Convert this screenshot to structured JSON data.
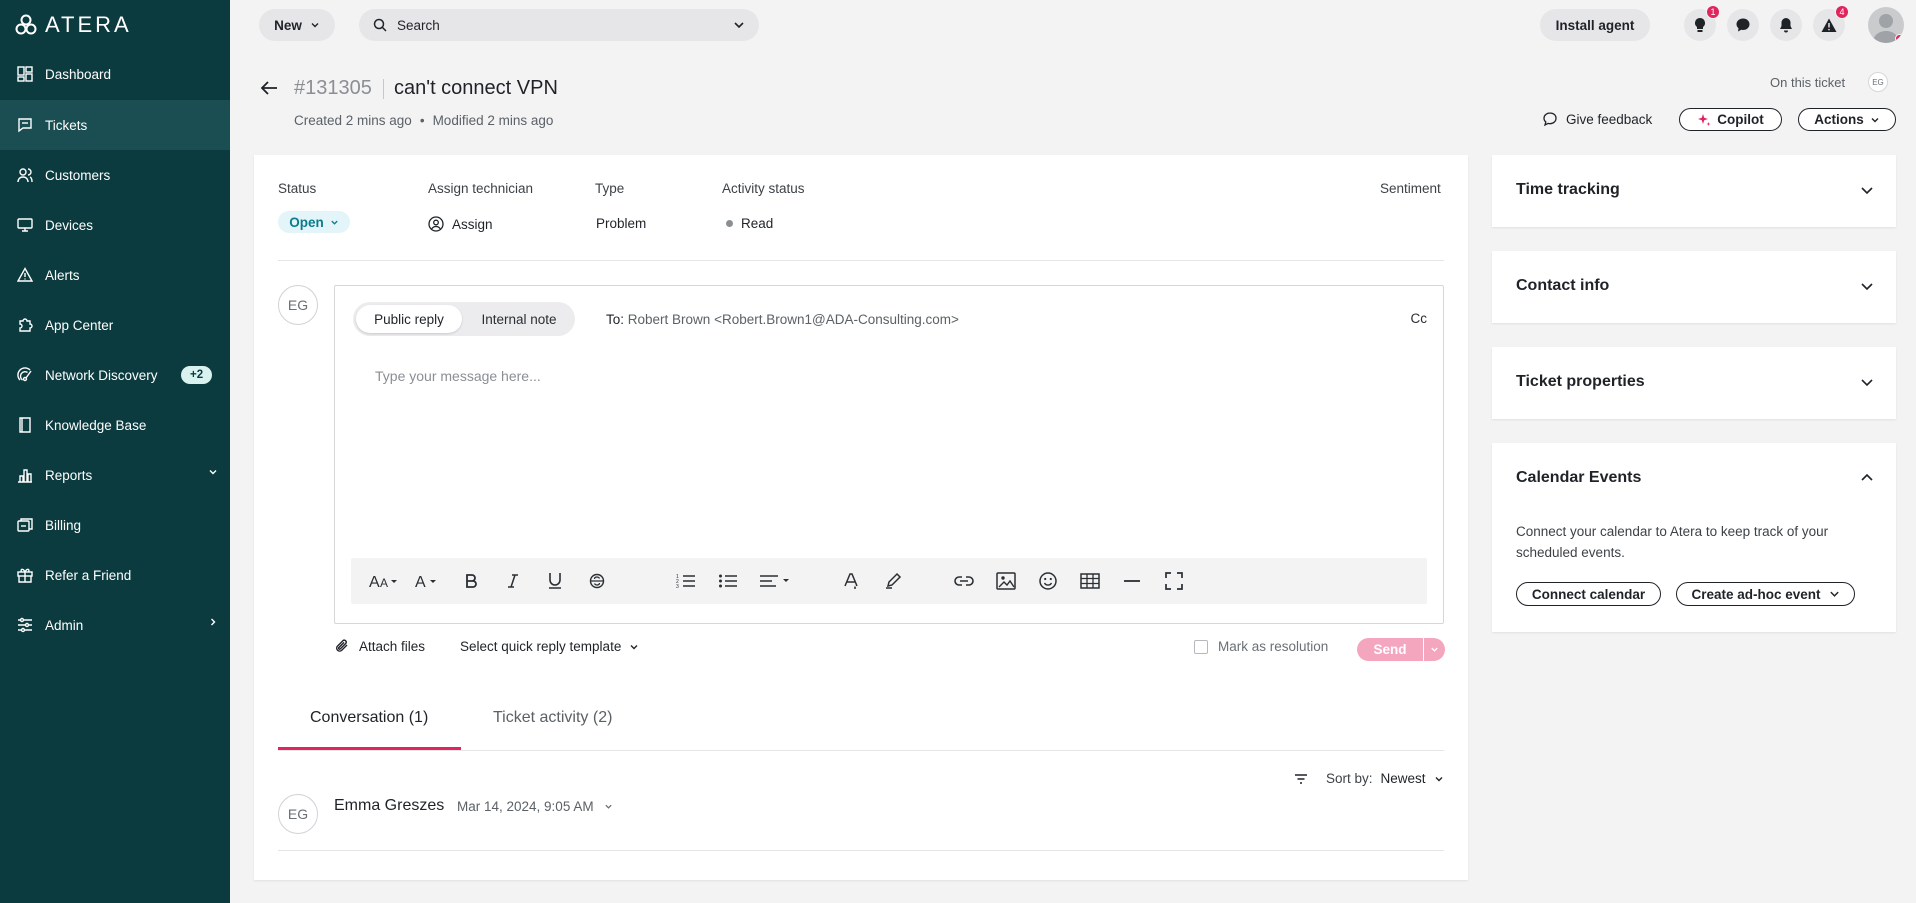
{
  "app": {
    "logo_text": "ATERA",
    "brand_color": "#0b3b3f",
    "accent_color": "#e0245e"
  },
  "sidebar": {
    "items": [
      {
        "label": "Dashboard",
        "icon": "dashboard-icon"
      },
      {
        "label": "Tickets",
        "icon": "tickets-icon",
        "active": true
      },
      {
        "label": "Customers",
        "icon": "customers-icon"
      },
      {
        "label": "Devices",
        "icon": "devices-icon"
      },
      {
        "label": "Alerts",
        "icon": "alert-icon"
      },
      {
        "label": "App Center",
        "icon": "app-center-icon"
      },
      {
        "label": "Network Discovery",
        "icon": "network-icon",
        "badge": "+2"
      },
      {
        "label": "Knowledge Base",
        "icon": "book-icon"
      },
      {
        "label": "Reports",
        "icon": "reports-icon"
      },
      {
        "label": "Billing",
        "icon": "billing-icon"
      },
      {
        "label": "Refer a Friend",
        "icon": "gift-icon"
      },
      {
        "label": "Admin",
        "icon": "admin-icon"
      }
    ]
  },
  "topbar": {
    "new_label": "New",
    "search_placeholder": "Search",
    "install_label": "Install agent",
    "notif_counts": {
      "ideas": "1",
      "warnings": "4"
    }
  },
  "ticket": {
    "number": "#131305",
    "title": "can't connect VPN",
    "created": "Created 2 mins ago",
    "bullet": "•",
    "modified": "Modified 2 mins ago",
    "on_this_ticket": "On this ticket",
    "viewer_initials": "EG",
    "feedback": "Give feedback",
    "copilot": "Copilot",
    "actions": "Actions",
    "fields": {
      "status_label": "Status",
      "status_value": "Open",
      "tech_label": "Assign technician",
      "tech_value": "Assign",
      "type_label": "Type",
      "type_value": "Problem",
      "activity_label": "Activity status",
      "activity_value": "Read",
      "sentiment_label": "Sentiment"
    }
  },
  "editor": {
    "avatar": "EG",
    "public_reply": "Public reply",
    "internal_note": "Internal note",
    "to_label": "To:",
    "to_value": "Robert Brown <Robert.Brown1@ADA-Consulting.com>",
    "cc": "Cc",
    "placeholder": "Type your message here...",
    "attach": "Attach files",
    "template": "Select quick reply template",
    "resolution": "Mark as resolution",
    "send": "Send"
  },
  "conversation": {
    "tabs": [
      "Conversation (1)",
      "Ticket activity (2)"
    ],
    "sort_label": "Sort by:",
    "sort_value": "Newest",
    "entries": [
      {
        "initials": "EG",
        "author": "Emma Greszes",
        "date": "Mar 14, 2024, 9:05 AM"
      }
    ]
  },
  "panels": {
    "time_tracking": "Time tracking",
    "contact_info": "Contact info",
    "ticket_properties": "Ticket properties",
    "calendar_events": "Calendar Events",
    "calendar_text": "Connect your calendar to Atera to keep track of your scheduled events.",
    "connect_calendar": "Connect calendar",
    "adhoc_event": "Create ad-hoc event"
  }
}
